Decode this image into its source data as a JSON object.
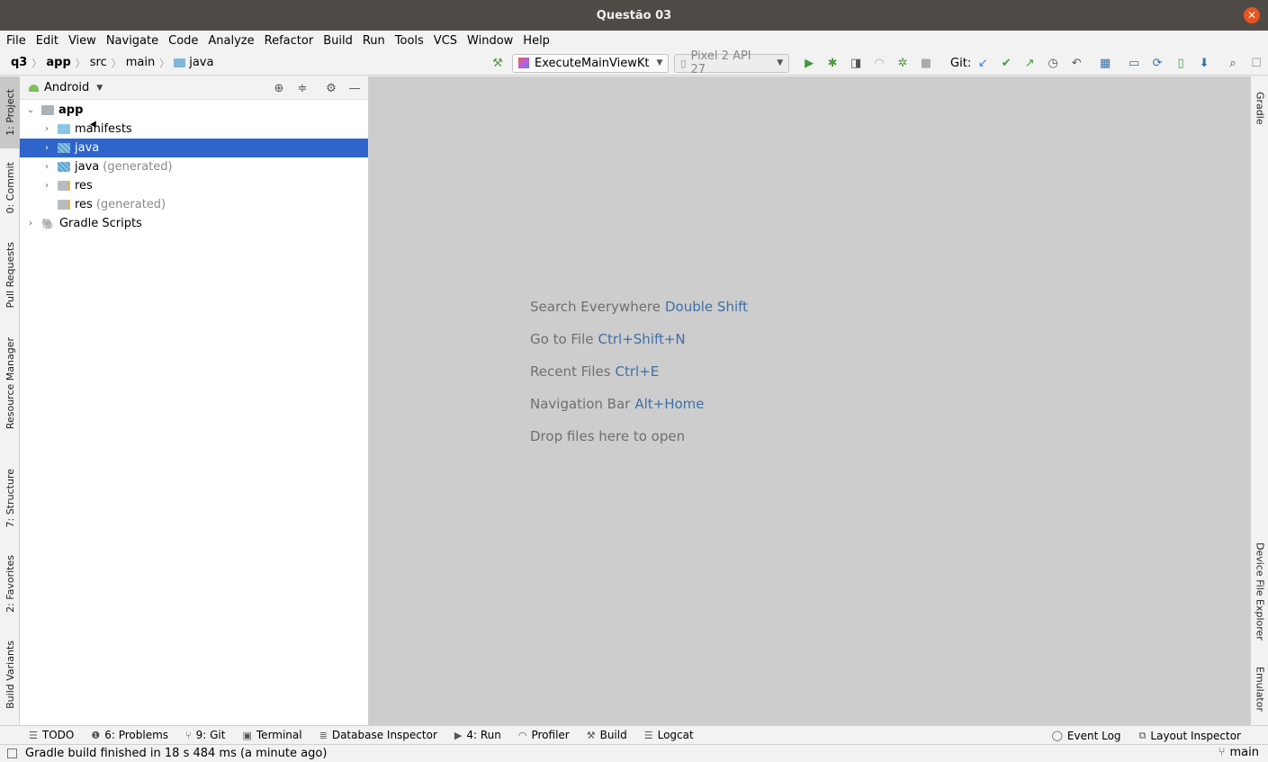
{
  "window": {
    "title": "Questão 03"
  },
  "menu": [
    "File",
    "Edit",
    "View",
    "Navigate",
    "Code",
    "Analyze",
    "Refactor",
    "Build",
    "Run",
    "Tools",
    "VCS",
    "Window",
    "Help"
  ],
  "breadcrumbs": [
    "q3",
    "app",
    "src",
    "main",
    "java"
  ],
  "toolbar": {
    "run_config": "ExecuteMainViewKt",
    "device": "Pixel 2 API 27",
    "git_label": "Git:"
  },
  "left_tabs": [
    "1: Project",
    "0: Commit",
    "Pull Requests",
    "Resource Manager",
    "7: Structure",
    "2: Favorites",
    "Build Variants"
  ],
  "right_tabs": [
    "Gradle",
    "Device File Explorer",
    "Emulator"
  ],
  "project_panel": {
    "view_mode": "Android",
    "tree": [
      {
        "label": "app",
        "suffix": ""
      },
      {
        "label": "manifests",
        "suffix": ""
      },
      {
        "label": "java",
        "suffix": ""
      },
      {
        "label": "java",
        "suffix": "(generated)"
      },
      {
        "label": "res",
        "suffix": ""
      },
      {
        "label": "res",
        "suffix": "(generated)"
      },
      {
        "label": "Gradle Scripts",
        "suffix": ""
      }
    ]
  },
  "editor_hints": [
    {
      "text": "Search Everywhere",
      "key": "Double Shift"
    },
    {
      "text": "Go to File",
      "key": "Ctrl+Shift+N"
    },
    {
      "text": "Recent Files",
      "key": "Ctrl+E"
    },
    {
      "text": "Navigation Bar",
      "key": "Alt+Home"
    },
    {
      "text": "Drop files here to open",
      "key": ""
    }
  ],
  "bottom_tabs": [
    "TODO",
    "6: Problems",
    "9: Git",
    "Terminal",
    "Database Inspector",
    "4: Run",
    "Profiler",
    "Build",
    "Logcat"
  ],
  "bottom_right_tabs": [
    "Event Log",
    "Layout Inspector"
  ],
  "status": {
    "message": "Gradle build finished in 18 s 484 ms (a minute ago)",
    "branch": "main"
  },
  "colors": {
    "selection": "#2f65ca",
    "titlebar": "#504a46",
    "close": "#e9541e",
    "hint_key": "#3f6fa6"
  }
}
